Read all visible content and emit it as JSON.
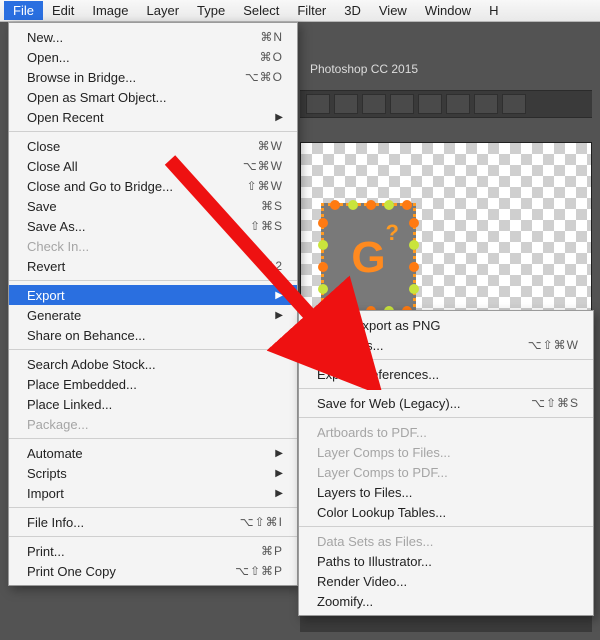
{
  "menubar": {
    "items": [
      "File",
      "Edit",
      "Image",
      "Layer",
      "Type",
      "Select",
      "Filter",
      "3D",
      "View",
      "Window",
      "H"
    ]
  },
  "document": {
    "tab_label": "Photoshop CC 2015"
  },
  "canvas": {
    "big_glyph": "G",
    "qmark": "?"
  },
  "file_menu": [
    {
      "label": "New...",
      "shortcut": "⌘N"
    },
    {
      "label": "Open...",
      "shortcut": "⌘O"
    },
    {
      "label": "Browse in Bridge...",
      "shortcut": "⌥⌘O"
    },
    {
      "label": "Open as Smart Object..."
    },
    {
      "label": "Open Recent",
      "submenu": true
    },
    {
      "sep": true
    },
    {
      "label": "Close",
      "shortcut": "⌘W"
    },
    {
      "label": "Close All",
      "shortcut": "⌥⌘W"
    },
    {
      "label": "Close and Go to Bridge...",
      "shortcut": "⇧⌘W"
    },
    {
      "label": "Save",
      "shortcut": "⌘S"
    },
    {
      "label": "Save As...",
      "shortcut": "⇧⌘S"
    },
    {
      "label": "Check In...",
      "disabled": true
    },
    {
      "label": "Revert",
      "shortcut": "F12"
    },
    {
      "sep": true
    },
    {
      "label": "Export",
      "submenu": true,
      "highlight": true
    },
    {
      "label": "Generate",
      "submenu": true
    },
    {
      "label": "Share on Behance..."
    },
    {
      "sep": true
    },
    {
      "label": "Search Adobe Stock..."
    },
    {
      "label": "Place Embedded..."
    },
    {
      "label": "Place Linked..."
    },
    {
      "label": "Package...",
      "disabled": true
    },
    {
      "sep": true
    },
    {
      "label": "Automate",
      "submenu": true
    },
    {
      "label": "Scripts",
      "submenu": true
    },
    {
      "label": "Import",
      "submenu": true
    },
    {
      "sep": true
    },
    {
      "label": "File Info...",
      "shortcut": "⌥⇧⌘I"
    },
    {
      "sep": true
    },
    {
      "label": "Print...",
      "shortcut": "⌘P"
    },
    {
      "label": "Print One Copy",
      "shortcut": "⌥⇧⌘P"
    }
  ],
  "export_submenu": [
    {
      "label": "Quick Export as PNG"
    },
    {
      "label": "Export As...",
      "shortcut": "⌥⇧⌘W"
    },
    {
      "sep": true
    },
    {
      "label": "Export Preferences..."
    },
    {
      "sep": true
    },
    {
      "label": "Save for Web (Legacy)...",
      "shortcut": "⌥⇧⌘S"
    },
    {
      "sep": true
    },
    {
      "label": "Artboards to PDF...",
      "disabled": true
    },
    {
      "label": "Layer Comps to Files...",
      "disabled": true
    },
    {
      "label": "Layer Comps to PDF...",
      "disabled": true
    },
    {
      "label": "Layers to Files..."
    },
    {
      "label": "Color Lookup Tables..."
    },
    {
      "sep": true
    },
    {
      "label": "Data Sets as Files...",
      "disabled": true
    },
    {
      "label": "Paths to Illustrator..."
    },
    {
      "label": "Render Video..."
    },
    {
      "label": "Zoomify..."
    }
  ]
}
